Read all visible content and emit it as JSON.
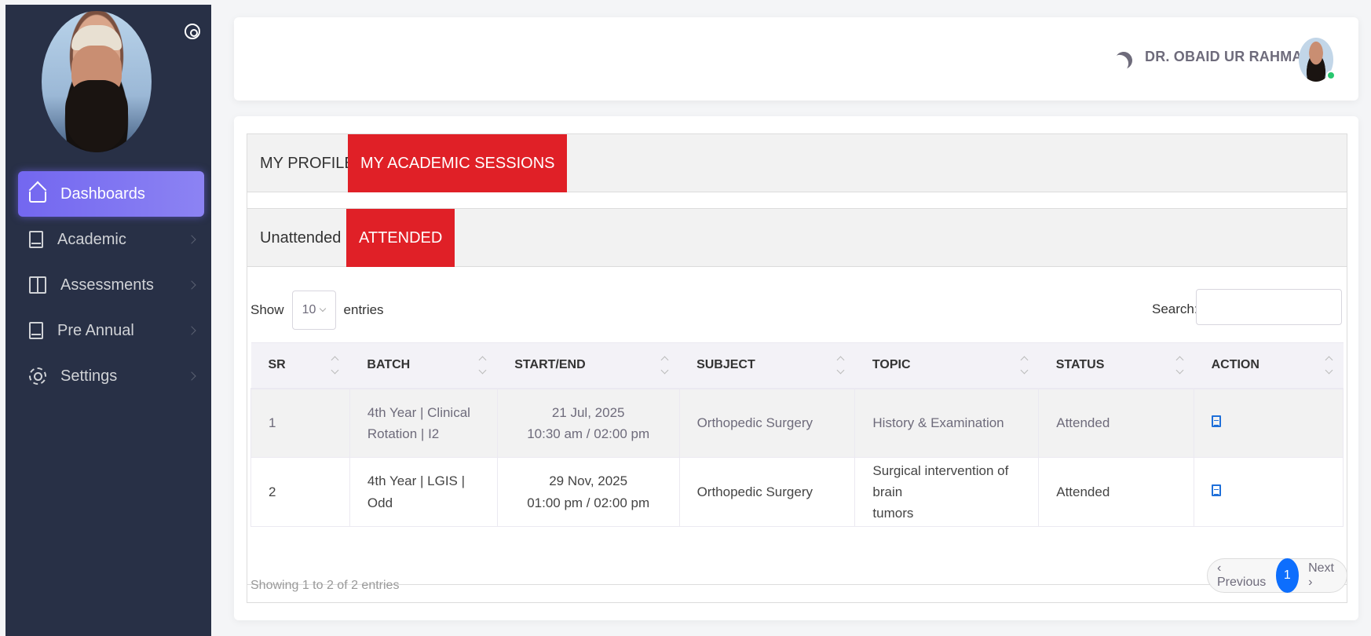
{
  "sidebar": {
    "items": [
      {
        "label": "Dashboards",
        "icon": "home-icon",
        "active": true
      },
      {
        "label": "Academic",
        "icon": "book-icon"
      },
      {
        "label": "Assessments",
        "icon": "open-book-icon"
      },
      {
        "label": "Pre Annual",
        "icon": "book-icon"
      },
      {
        "label": "Settings",
        "icon": "gear-icon"
      }
    ]
  },
  "header": {
    "user_name": "DR. OBAID UR RAHMAN"
  },
  "tabs": {
    "primary": [
      "MY PROFILE",
      "MY ACADEMIC SESSIONS"
    ],
    "secondary": [
      "Unattended",
      "ATTENDED"
    ]
  },
  "table_controls": {
    "show_label": "Show",
    "entries_value": "10",
    "entries_label": "entries",
    "search_label": "Search:"
  },
  "table": {
    "columns": [
      "SR",
      "BATCH",
      "START/END",
      "SUBJECT",
      "TOPIC",
      "STATUS",
      "ACTION"
    ],
    "rows": [
      {
        "sr": "1",
        "batch_line1": "4th Year | Clinical",
        "batch_line2": "Rotation | I2",
        "date": "21 Jul, 2025",
        "time": "10:30 am / 02:00 pm",
        "subject": "Orthopedic Surgery",
        "topic_line1": "History & Examination",
        "topic_line2": "",
        "status": "Attended"
      },
      {
        "sr": "2",
        "batch_line1": "4th Year | LGIS | Odd",
        "batch_line2": "",
        "date": "29 Nov, 2025",
        "time": "01:00 pm / 02:00 pm",
        "subject": "Orthopedic Surgery",
        "topic_line1": "Surgical intervention of brain",
        "topic_line2": "tumors",
        "status": "Attended"
      }
    ]
  },
  "footer": {
    "info": "Showing 1 to 2 of 2 entries",
    "previous": "‹ Previous",
    "page": "1",
    "next": "Next ›"
  },
  "colors": {
    "sidebar_bg": "#283046",
    "active_nav": "#7367f0",
    "active_tab": "#e02027",
    "page_button": "#0d6efd",
    "online": "#28c76f"
  }
}
